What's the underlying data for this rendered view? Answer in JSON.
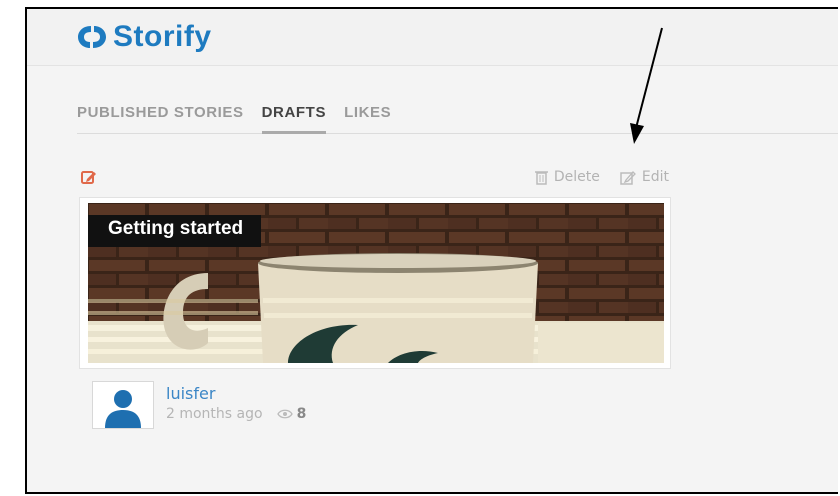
{
  "app": {
    "name": "Storify",
    "brand_color": "#1e7bc0"
  },
  "tabs": [
    {
      "label": "PUBLISHED STORIES",
      "active": false
    },
    {
      "label": "DRAFTS",
      "active": true
    },
    {
      "label": "LIKES",
      "active": false
    }
  ],
  "toolbar": {
    "new_icon": "edit-square-icon",
    "delete_label": "Delete",
    "delete_icon": "trash-icon",
    "edit_label": "Edit",
    "edit_icon": "pencil-icon"
  },
  "story": {
    "title": "Getting started"
  },
  "author": {
    "name": "luisfer",
    "time_ago": "2 months ago",
    "views": "8",
    "avatar_icon": "user-silhouette-icon",
    "views_icon": "eye-icon"
  },
  "colors": {
    "link": "#3b86c6",
    "accent_orange": "#e0694a"
  }
}
